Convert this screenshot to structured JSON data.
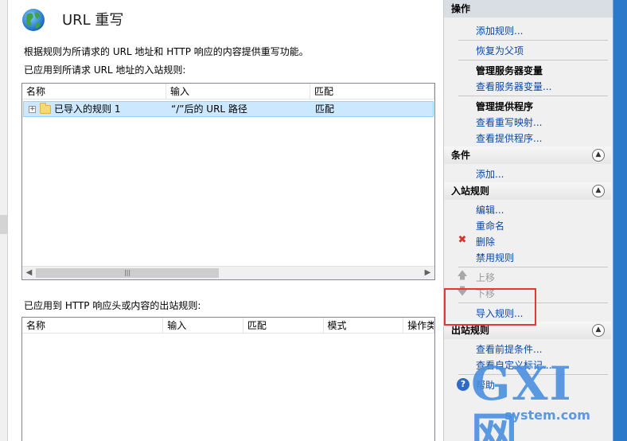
{
  "header": {
    "title": "URL 重写"
  },
  "main": {
    "description": "根据规则为所请求的 URL 地址和 HTTP 响应的内容提供重写功能。",
    "inbound": {
      "label": "已应用到所请求 URL 地址的入站规则:",
      "columns": [
        "名称",
        "输入",
        "匹配"
      ],
      "rows": [
        {
          "name": "已导入的规则 1",
          "input": "“/”后的 URL 路径",
          "match": "匹配"
        }
      ],
      "scroll_grip": "|||"
    },
    "outbound": {
      "label": "已应用到 HTTP 响应头或内容的出站规则:",
      "columns": [
        "名称",
        "输入",
        "匹配",
        "模式",
        "操作类"
      ]
    }
  },
  "actions": {
    "title": "操作",
    "items_top": [
      {
        "label": "添加规则...",
        "style": "link"
      },
      {
        "label": "恢复为父项",
        "style": "link"
      },
      {
        "label": "管理服务器变量",
        "style": "bold"
      },
      {
        "label": "查看服务器变量...",
        "style": "link"
      },
      {
        "label": "管理提供程序",
        "style": "bold"
      },
      {
        "label": "查看重写映射...",
        "style": "link"
      },
      {
        "label": "查看提供程序...",
        "style": "link"
      }
    ],
    "conditions": {
      "title": "条件",
      "add": "添加..."
    },
    "inbound": {
      "title": "入站规则",
      "edit": "编辑...",
      "rename": "重命名",
      "delete": "删除",
      "disable": "禁用规则",
      "move_up": "上移",
      "move_down": "下移",
      "import": "导入规则..."
    },
    "outbound": {
      "title": "出站规则",
      "view_preconditions": "查看前提条件...",
      "view_custom_tags": "查看自定义标记..."
    },
    "help": "帮助"
  },
  "watermark": {
    "logo": "GXI网",
    "sub": "system.com"
  },
  "colors": {
    "accent": "#0a48a8",
    "highlight": "#e53935",
    "selection": "#cce8ff"
  }
}
